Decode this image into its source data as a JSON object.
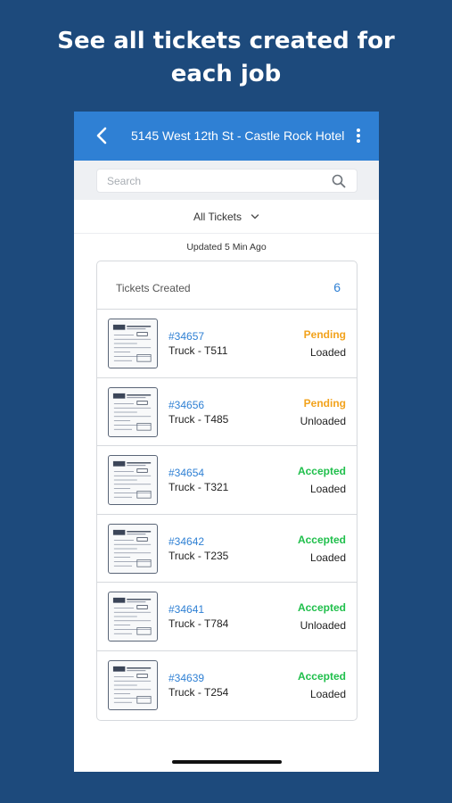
{
  "promo": {
    "line1": "See all tickets created for",
    "line2": "each job"
  },
  "header": {
    "title": "5145 West 12th St - Castle Rock Hotel",
    "back_icon": "chevron-left-icon",
    "menu_icon": "more-vertical-icon"
  },
  "search": {
    "placeholder": "Search",
    "value": "",
    "icon": "search-icon"
  },
  "filter": {
    "selected": "All Tickets",
    "icon": "chevron-down-icon"
  },
  "updated": "Updated 5 Min Ago",
  "summary": {
    "label": "Tickets Created",
    "count": "6"
  },
  "colors": {
    "primary": "#2f80d4",
    "background": "#1d4a7c",
    "pending": "#f2a21b",
    "accepted": "#1fbf4b"
  },
  "tickets": [
    {
      "id": "#34657",
      "truck": "Truck - T511",
      "status": "Pending",
      "load": "Loaded"
    },
    {
      "id": "#34656",
      "truck": "Truck - T485",
      "status": "Pending",
      "load": "Unloaded"
    },
    {
      "id": "#34654",
      "truck": "Truck - T321",
      "status": "Accepted",
      "load": "Loaded"
    },
    {
      "id": "#34642",
      "truck": "Truck - T235",
      "status": "Accepted",
      "load": "Loaded"
    },
    {
      "id": "#34641",
      "truck": "Truck - T784",
      "status": "Accepted",
      "load": "Unloaded"
    },
    {
      "id": "#34639",
      "truck": "Truck - T254",
      "status": "Accepted",
      "load": "Loaded"
    }
  ]
}
